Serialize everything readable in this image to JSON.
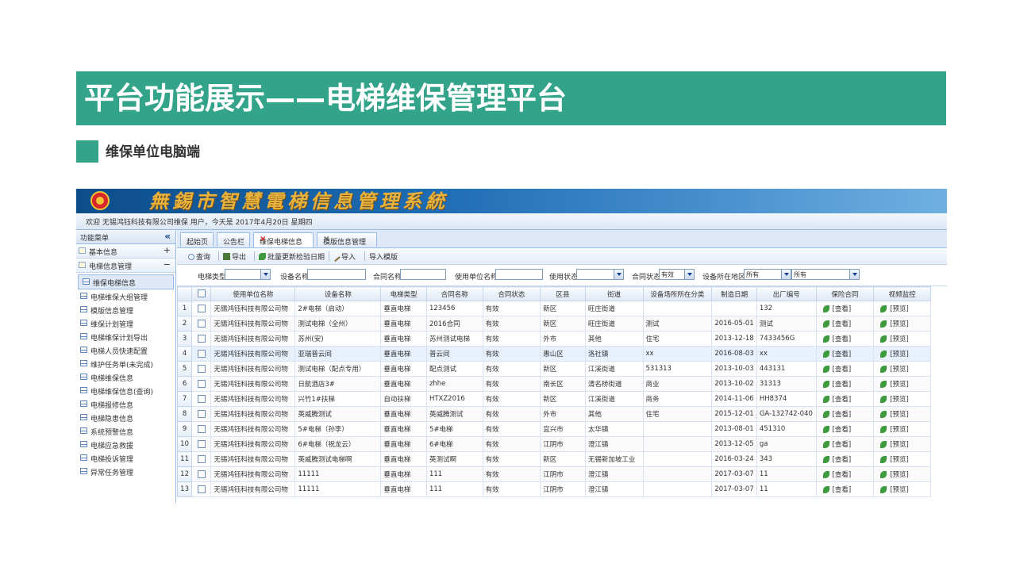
{
  "slide": {
    "title": "平台功能展示——电梯维保管理平台",
    "subtitle": "维保单位电脑端"
  },
  "app": {
    "system_title": "無錫市智慧電梯信息管理系統",
    "welcome": "欢迎 无锡鸿钰科技有限公司维保 用户，今天是 2017年4月20日 星期四",
    "sidebar": {
      "header": "功能菜单",
      "collapse": "«",
      "groups": [
        {
          "label": "基本信息",
          "toggle": "+"
        },
        {
          "label": "电梯信息管理",
          "toggle": "−"
        }
      ],
      "items": [
        {
          "label": "维保电梯信息"
        },
        {
          "label": "电梯维保大组管理"
        },
        {
          "label": "模版信息管理"
        },
        {
          "label": "维保计划管理"
        },
        {
          "label": "电梯维保计划导出"
        },
        {
          "label": "电梯人员快速配置"
        },
        {
          "label": "维护任务单(未完成)"
        },
        {
          "label": "电梯维保信息"
        },
        {
          "label": "电梯维保信息(查询)"
        },
        {
          "label": "电梯报修信息"
        },
        {
          "label": "电梯隐患信息"
        },
        {
          "label": "系统预警信息"
        },
        {
          "label": "电梯应急救援"
        },
        {
          "label": "电梯投诉管理"
        },
        {
          "label": "异常任务管理"
        }
      ]
    },
    "tabs": [
      {
        "label": "起始页",
        "close": ""
      },
      {
        "label": "公告栏",
        "close": ""
      },
      {
        "label": "维保电梯信息",
        "close": "×"
      },
      {
        "label": "模版信息管理",
        "close": "×"
      }
    ],
    "toolbar": {
      "query": "查询",
      "export": "导出",
      "batch_update": "批量更新检验日期",
      "import": "导入",
      "import_template": "导入模版"
    },
    "filters": {
      "elevator_type_label": "电梯类型",
      "device_name_label": "设备名称",
      "contract_name_label": "合同名称",
      "user_unit_label": "使用单位名称",
      "use_status_label": "使用状态",
      "contract_status_label": "合同状态",
      "contract_status_value": "有效",
      "location_label": "设备所在地区",
      "location_value_1": "所有",
      "location_value_2": "所有"
    },
    "grid": {
      "columns": [
        "",
        "",
        "使用单位名称",
        "设备名称",
        "电梯类型",
        "合同名称",
        "合同状态",
        "区县",
        "街道",
        "设备场所所在分类",
        "制造日期",
        "出厂编号",
        "保险合同",
        "视频监控"
      ],
      "view_label": "[查看]",
      "preview_label": "[预览]",
      "rows": [
        {
          "n": "1",
          "unit": "无锡鸿钰科技有限公司物",
          "device": "2#电梯（启动）",
          "type": "垂直电梯",
          "contract": "123456",
          "status": "有效",
          "district": "新区",
          "street": "旺庄街道",
          "place": "",
          "date": "",
          "serial": "132"
        },
        {
          "n": "2",
          "unit": "无锡鸿钰科技有限公司物",
          "device": "测试电梯（全州）",
          "type": "垂直电梯",
          "contract": "2016合同",
          "status": "有效",
          "district": "新区",
          "street": "旺庄街道",
          "place": "测试",
          "date": "2016-05-01",
          "serial": "测试"
        },
        {
          "n": "3",
          "unit": "无锡鸿钰科技有限公司物",
          "device": "苏州(安)",
          "type": "垂直电梯",
          "contract": "苏州测试电梯",
          "status": "有效",
          "district": "外市",
          "street": "其他",
          "place": "住宅",
          "date": "2013-12-18",
          "serial": "7433456G"
        },
        {
          "n": "4",
          "unit": "无锡鸿钰科技有限公司物",
          "device": "亚瑞普云间",
          "type": "垂直电梯",
          "contract": "普云间",
          "status": "有效",
          "district": "惠山区",
          "street": "洛社镇",
          "place": "xx",
          "date": "2016-08-03",
          "serial": "xx"
        },
        {
          "n": "5",
          "unit": "无锡鸿钰科技有限公司物",
          "device": "测试电梯（配点专用）",
          "type": "垂直电梯",
          "contract": "配点测试",
          "status": "有效",
          "district": "新区",
          "street": "江溪街道",
          "place": "531313",
          "date": "2013-10-03",
          "serial": "443131"
        },
        {
          "n": "6",
          "unit": "无锡鸿钰科技有限公司物",
          "device": "日航酒店3#",
          "type": "垂直电梯",
          "contract": "zhhe",
          "status": "有效",
          "district": "南长区",
          "street": "清名桥街道",
          "place": "商业",
          "date": "2013-10-02",
          "serial": "31313"
        },
        {
          "n": "7",
          "unit": "无锡鸿钰科技有限公司物",
          "device": "兴竹1#扶梯",
          "type": "自动扶梯",
          "contract": "HTXZ2016",
          "status": "有效",
          "district": "新区",
          "street": "江溪街道",
          "place": "商务",
          "date": "2014-11-06",
          "serial": "HH8374"
        },
        {
          "n": "8",
          "unit": "无锡鸿钰科技有限公司物",
          "device": "英威腾测试",
          "type": "垂直电梯",
          "contract": "英威腾测试",
          "status": "有效",
          "district": "外市",
          "street": "其他",
          "place": "住宅",
          "date": "2015-12-01",
          "serial": "GA-132742-040"
        },
        {
          "n": "9",
          "unit": "无锡鸿钰科技有限公司物",
          "device": "5#电梯（孙李）",
          "type": "垂直电梯",
          "contract": "5#电梯",
          "status": "有效",
          "district": "宜兴市",
          "street": "太华镇",
          "place": "",
          "date": "2013-08-01",
          "serial": "451310"
        },
        {
          "n": "10",
          "unit": "无锡鸿钰科技有限公司物",
          "device": "6#电梯（祝龙云）",
          "type": "垂直电梯",
          "contract": "6#电梯",
          "status": "有效",
          "district": "江阴市",
          "street": "澄江镇",
          "place": "",
          "date": "2013-12-05",
          "serial": "ga"
        },
        {
          "n": "11",
          "unit": "无锡鸿钰科技有限公司物",
          "device": "英威腾测试电梯啊",
          "type": "垂直电梯",
          "contract": "英测试啊",
          "status": "有效",
          "district": "新区",
          "street": "无锡新加坡工业",
          "place": "",
          "date": "2016-03-24",
          "serial": "343"
        },
        {
          "n": "12",
          "unit": "无锡鸿钰科技有限公司物",
          "device": "11111",
          "type": "垂直电梯",
          "contract": "111",
          "status": "有效",
          "district": "江阴市",
          "street": "澄江镇",
          "place": "",
          "date": "2017-03-07",
          "serial": "11"
        },
        {
          "n": "13",
          "unit": "无锡鸿钰科技有限公司物",
          "device": "11111",
          "type": "垂直电梯",
          "contract": "111",
          "status": "有效",
          "district": "江阴市",
          "street": "澄江镇",
          "place": "",
          "date": "2017-03-07",
          "serial": "11"
        }
      ]
    }
  }
}
